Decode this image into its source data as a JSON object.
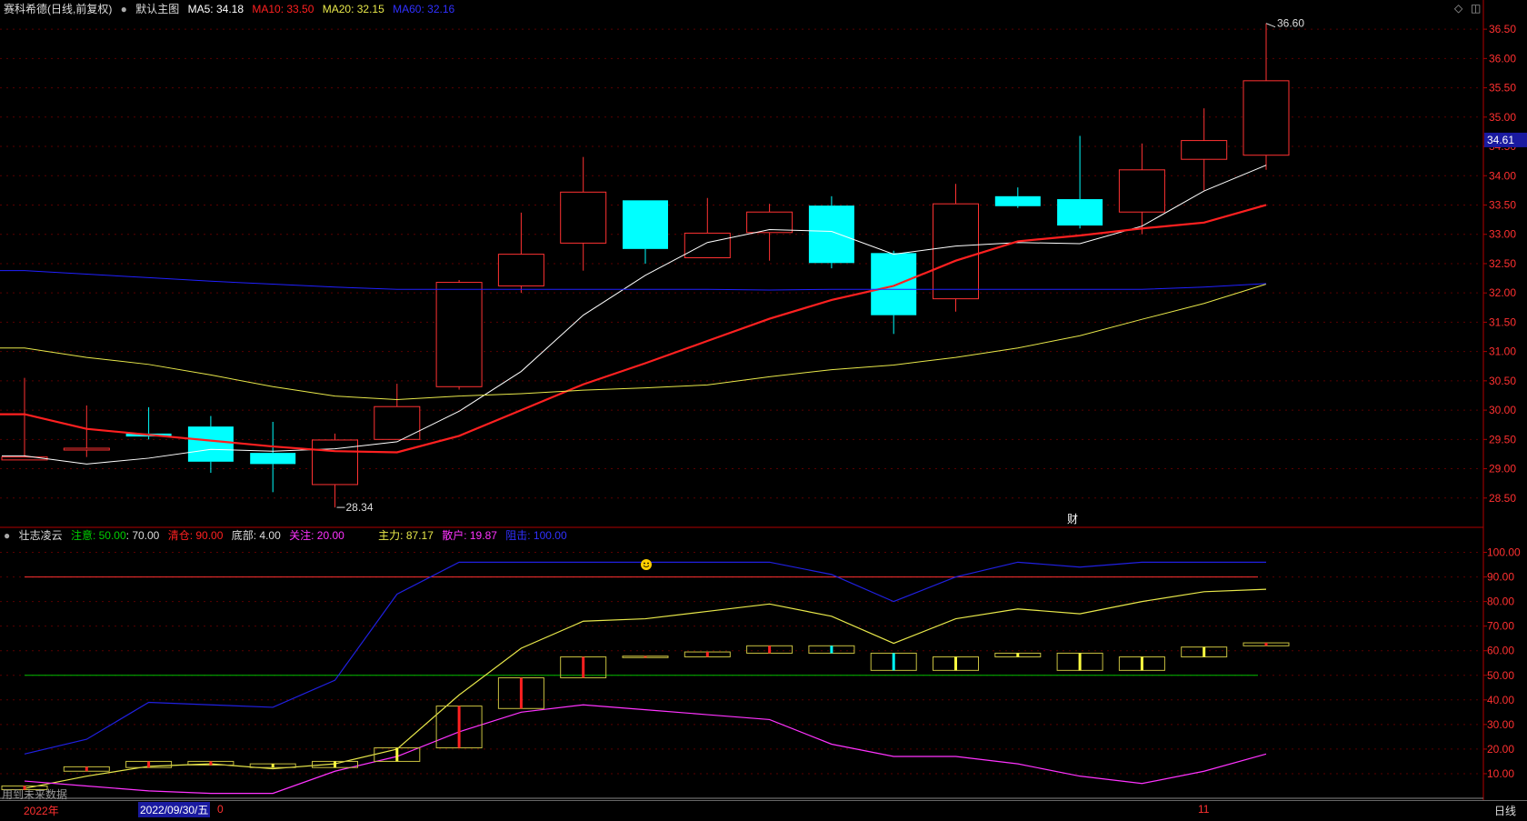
{
  "header": {
    "title": "赛科希德(日线,前复权)",
    "main_chart_label": "默认主图",
    "ma5": "MA5: 34.18",
    "ma10": "MA10: 33.50",
    "ma20": "MA20: 32.15",
    "ma60": "MA60: 32.16"
  },
  "indicator_header": {
    "name": "壮志凌云",
    "attention": "注意: 50.00",
    "attention2": ": 70.00",
    "clear": "清仓: 90.00",
    "bottom": "底部: 4.00",
    "focus": "关注: 20.00",
    "main_force": "主力: 87.17",
    "retail": "散户: 19.87",
    "leader": "阻击: 100.00"
  },
  "colors": {
    "up": "#ff3232",
    "down": "#00ffff",
    "ma5": "#ffffff",
    "ma10": "#ff2020",
    "ma20": "#e8e84a",
    "ma60": "#2020ff",
    "axis": "#b00000",
    "main_force": "#e8e84a",
    "retail": "#ff33ff",
    "leader": "#2020e0",
    "green_line": "#00c000"
  },
  "annotations": {
    "high": "36.60",
    "low": "28.34",
    "price_tag": "34.61",
    "cai_label": "财",
    "bottom_note": "用到未来数据",
    "year": "2022年",
    "date": "2022/09/30/五",
    "zero": "0",
    "month": "11",
    "period": "日线"
  },
  "chart_data": [
    {
      "type": "candlestick",
      "title": "赛科希德(日线,前复权)",
      "ylim": [
        28.0,
        36.75
      ],
      "y_ticks": [
        "28.50",
        "29.00",
        "29.50",
        "30.00",
        "30.50",
        "31.00",
        "31.50",
        "32.00",
        "32.50",
        "33.00",
        "33.50",
        "34.00",
        "34.50",
        "35.00",
        "35.50",
        "36.00",
        "36.50"
      ],
      "candles": [
        {
          "o": 29.15,
          "h": 30.55,
          "l": 29.15,
          "c": 29.2
        },
        {
          "o": 29.35,
          "h": 30.08,
          "l": 29.2,
          "c": 29.35
        },
        {
          "o": 29.6,
          "h": 30.05,
          "l": 29.5,
          "c": 29.55
        },
        {
          "o": 29.72,
          "h": 29.9,
          "l": 28.93,
          "c": 29.12
        },
        {
          "o": 29.27,
          "h": 29.8,
          "l": 28.6,
          "c": 29.08
        },
        {
          "o": 28.73,
          "h": 29.6,
          "l": 28.34,
          "c": 29.49
        },
        {
          "o": 29.5,
          "h": 30.45,
          "l": 29.5,
          "c": 30.06
        },
        {
          "o": 30.4,
          "h": 32.22,
          "l": 30.35,
          "c": 32.18
        },
        {
          "o": 32.12,
          "h": 33.37,
          "l": 32.0,
          "c": 32.66
        },
        {
          "o": 32.85,
          "h": 34.32,
          "l": 32.38,
          "c": 33.72
        },
        {
          "o": 33.58,
          "h": 33.58,
          "l": 32.5,
          "c": 32.75
        },
        {
          "o": 32.6,
          "h": 33.62,
          "l": 32.6,
          "c": 33.02
        },
        {
          "o": 33.03,
          "h": 33.52,
          "l": 32.55,
          "c": 33.38
        },
        {
          "o": 33.49,
          "h": 33.65,
          "l": 32.42,
          "c": 32.51
        },
        {
          "o": 32.68,
          "h": 32.72,
          "l": 31.3,
          "c": 31.62
        },
        {
          "o": 31.9,
          "h": 33.86,
          "l": 31.68,
          "c": 33.52
        },
        {
          "o": 33.65,
          "h": 33.8,
          "l": 33.45,
          "c": 33.48
        },
        {
          "o": 33.6,
          "h": 34.68,
          "l": 33.1,
          "c": 33.15
        },
        {
          "o": 33.38,
          "h": 34.55,
          "l": 33.0,
          "c": 34.1
        },
        {
          "o": 34.28,
          "h": 35.15,
          "l": 33.75,
          "c": 34.6
        },
        {
          "o": 34.35,
          "h": 36.6,
          "l": 34.1,
          "c": 35.62
        }
      ],
      "series": [
        {
          "name": "MA5",
          "values": [
            29.22,
            29.08,
            29.18,
            29.33,
            29.3,
            29.34,
            29.46,
            29.98,
            30.66,
            31.62,
            32.3,
            32.86,
            33.08,
            33.05,
            32.66,
            32.8,
            32.86,
            32.84,
            33.14,
            33.74,
            34.18
          ]
        },
        {
          "name": "MA10",
          "values": [
            29.93,
            29.68,
            29.58,
            29.48,
            29.38,
            29.3,
            29.28,
            29.56,
            30.0,
            30.44,
            30.8,
            31.18,
            31.56,
            31.88,
            32.12,
            32.55,
            32.88,
            32.98,
            33.1,
            33.2,
            33.5
          ]
        },
        {
          "name": "MA20",
          "values": [
            31.06,
            30.9,
            30.78,
            30.6,
            30.4,
            30.24,
            30.18,
            30.24,
            30.28,
            30.34,
            30.38,
            30.43,
            30.57,
            30.69,
            30.77,
            30.9,
            31.06,
            31.27,
            31.55,
            31.82,
            32.15
          ]
        },
        {
          "name": "MA60",
          "values": [
            32.38,
            32.32,
            32.26,
            32.2,
            32.15,
            32.1,
            32.06,
            32.06,
            32.06,
            32.06,
            32.06,
            32.06,
            32.05,
            32.06,
            32.06,
            32.06,
            32.06,
            32.06,
            32.06,
            32.1,
            32.16
          ]
        }
      ]
    },
    {
      "type": "line",
      "title": "壮志凌云",
      "ylim": [
        0,
        105
      ],
      "y_ticks": [
        "10.00",
        "20.00",
        "30.00",
        "40.00",
        "50.00",
        "60.00",
        "70.00",
        "80.00",
        "90.00",
        "100.00"
      ],
      "hlines": [
        50,
        70,
        90
      ],
      "series": [
        {
          "name": "主力",
          "values": [
            4,
            9,
            13,
            14,
            12,
            14,
            20,
            42,
            61,
            72,
            73,
            76,
            79,
            74,
            63,
            73,
            77,
            75,
            80,
            84,
            85
          ]
        },
        {
          "name": "散户",
          "values": [
            7,
            5,
            3,
            2,
            2,
            11,
            17,
            27,
            35,
            38,
            36,
            34,
            32,
            22,
            17,
            17,
            14,
            9,
            6,
            11,
            18
          ]
        },
        {
          "name": "阻击",
          "values": [
            18,
            24,
            39,
            38,
            37,
            48,
            83,
            96,
            96,
            96,
            96,
            96,
            96,
            91,
            80,
            90,
            96,
            94,
            96,
            96,
            96
          ]
        }
      ],
      "boxes": [
        {
          "lo": 3.5,
          "hi": 5,
          "bar": "red"
        },
        {
          "lo": 11,
          "hi": 12.8,
          "bar": "red"
        },
        {
          "lo": 12.5,
          "hi": 15,
          "bar": "red"
        },
        {
          "lo": 13.5,
          "hi": 15,
          "bar": "red"
        },
        {
          "lo": 12.5,
          "hi": 14,
          "bar": "yellow"
        },
        {
          "lo": 12.5,
          "hi": 15,
          "bar": "yellow"
        },
        {
          "lo": 15,
          "hi": 20.5,
          "bar": "yellow"
        },
        {
          "lo": 20.5,
          "hi": 37.5,
          "bar": "red"
        },
        {
          "lo": 36.5,
          "hi": 49,
          "bar": "red"
        },
        {
          "lo": 49,
          "hi": 57.5,
          "bar": "red"
        },
        {
          "lo": 57.2,
          "hi": 57.8,
          "bar": "red"
        },
        {
          "lo": 57.5,
          "hi": 59.5,
          "bar": "red"
        },
        {
          "lo": 59,
          "hi": 62,
          "bar": "red"
        },
        {
          "lo": 59,
          "hi": 62,
          "bar": "cyan"
        },
        {
          "lo": 52,
          "hi": 59,
          "bar": "cyan"
        },
        {
          "lo": 52,
          "hi": 57.5,
          "bar": "yellow"
        },
        {
          "lo": 57.5,
          "hi": 59,
          "bar": "yellow"
        },
        {
          "lo": 52,
          "hi": 59,
          "bar": "yellow"
        },
        {
          "lo": 52,
          "hi": 57.5,
          "bar": "yellow"
        },
        {
          "lo": 57.5,
          "hi": 61.5,
          "bar": "yellow"
        },
        {
          "lo": 62,
          "hi": 63.2,
          "bar": "red"
        }
      ]
    }
  ]
}
